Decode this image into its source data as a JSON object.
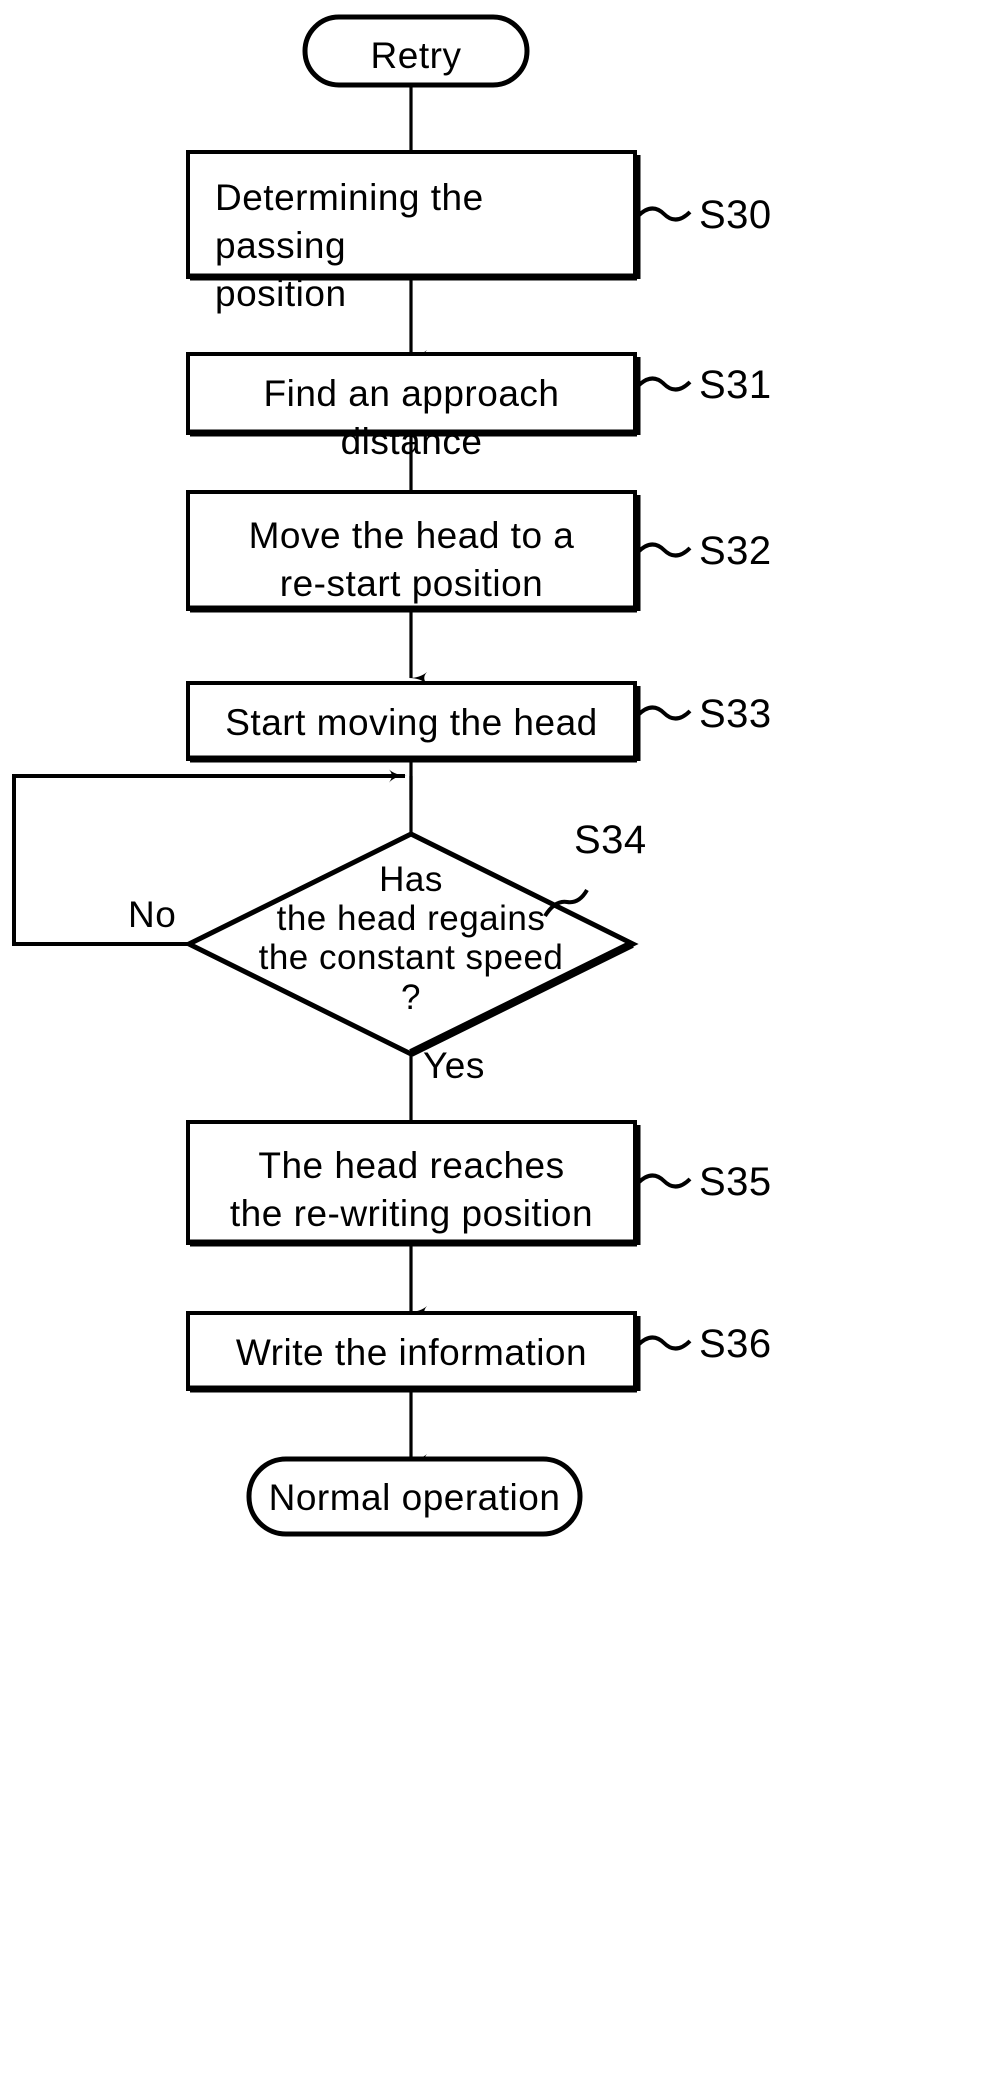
{
  "figure": {
    "type": "flowchart",
    "orientation": "vertical",
    "style": "patent-line-drawing",
    "colors": {
      "stroke": "#000000",
      "fill": "#ffffff",
      "background": "#ffffff"
    }
  },
  "nodes": {
    "start": {
      "id": "start",
      "shape": "terminator",
      "label": "Retry"
    },
    "s30": {
      "id": "S30",
      "shape": "process",
      "label": "Determining the passing\nposition",
      "align": "left",
      "ref": "S30"
    },
    "s31": {
      "id": "S31",
      "shape": "process",
      "label": "Find an approach distance",
      "align": "center",
      "ref": "S31"
    },
    "s32": {
      "id": "S32",
      "shape": "process",
      "label": "Move the head to a\nre-start position",
      "align": "center",
      "ref": "S32"
    },
    "s33": {
      "id": "S33",
      "shape": "process",
      "label": "Start moving the head",
      "align": "center",
      "ref": "S33"
    },
    "s34": {
      "id": "S34",
      "shape": "decision",
      "label": "Has\nthe head regains\nthe constant speed\n?",
      "ref": "S34",
      "branch_no": "No",
      "branch_yes": "Yes"
    },
    "s35": {
      "id": "S35",
      "shape": "process",
      "label": "The head reaches\nthe re-writing position",
      "align": "center",
      "ref": "S35"
    },
    "s36": {
      "id": "S36",
      "shape": "process",
      "label": "Write the information",
      "align": "center",
      "ref": "S36"
    },
    "end": {
      "id": "end",
      "shape": "terminator",
      "label": "Normal operation"
    }
  },
  "edges": [
    {
      "from": "start",
      "to": "s30",
      "label": ""
    },
    {
      "from": "s30",
      "to": "s31",
      "label": ""
    },
    {
      "from": "s31",
      "to": "s32",
      "label": ""
    },
    {
      "from": "s32",
      "to": "s33",
      "label": ""
    },
    {
      "from": "s33",
      "to": "s34",
      "label": ""
    },
    {
      "from": "s34",
      "to": "s34-loop",
      "label": "No"
    },
    {
      "from": "s34",
      "to": "s35",
      "label": "Yes"
    },
    {
      "from": "s35",
      "to": "s36",
      "label": ""
    },
    {
      "from": "s36",
      "to": "end",
      "label": ""
    }
  ]
}
